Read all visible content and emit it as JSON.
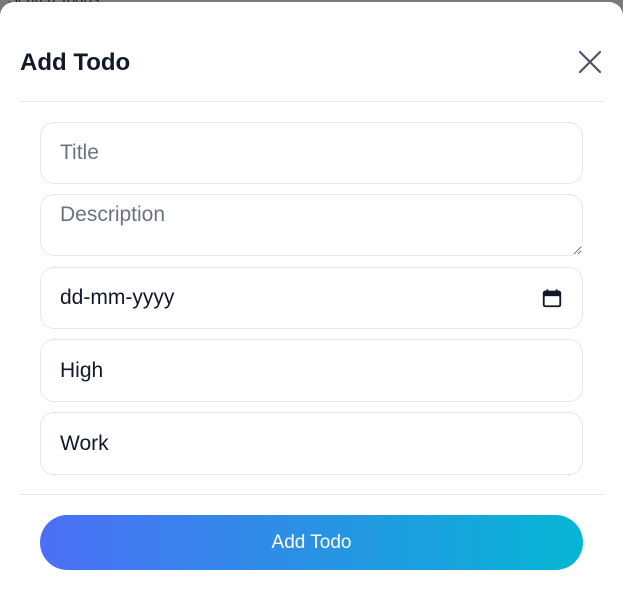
{
  "backdrop": {
    "text": "Search Todos"
  },
  "modal": {
    "title": "Add Todo",
    "close_icon": "close-icon"
  },
  "form": {
    "title_placeholder": "Title",
    "description_placeholder": "Description",
    "date_value": "dd-mm-yyyy",
    "date_icon": "calendar-icon",
    "priority_value": "High",
    "category_value": "Work"
  },
  "footer": {
    "submit_label": "Add Todo"
  },
  "colors": {
    "gradient_start": "#4c6ef5",
    "gradient_end": "#06b6d4",
    "border": "#e5e7eb",
    "text": "#111827"
  }
}
